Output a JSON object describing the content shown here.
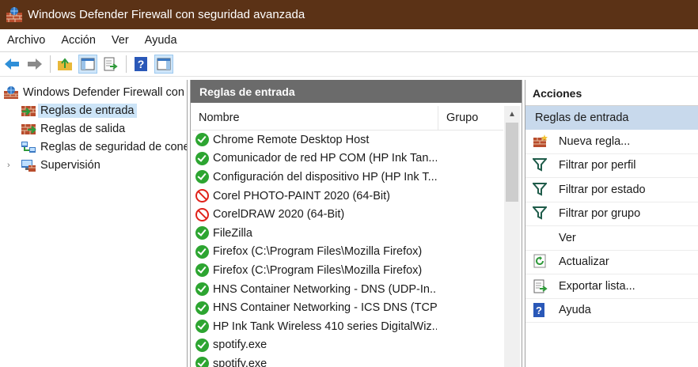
{
  "window": {
    "title": "Windows Defender Firewall con seguridad avanzada"
  },
  "menu": [
    "Archivo",
    "Acción",
    "Ver",
    "Ayuda"
  ],
  "toolbar": {
    "buttons": [
      "back-icon",
      "forward-icon",
      "up-folder-icon",
      "show-hide-tree-icon",
      "export-list-icon",
      "help-icon",
      "show-hide-action-pane-icon"
    ]
  },
  "tree": {
    "root": "Windows Defender Firewall con",
    "items": [
      {
        "label": "Reglas de entrada",
        "selected": true
      },
      {
        "label": "Reglas de salida"
      },
      {
        "label": "Reglas de seguridad de cone"
      },
      {
        "label": "Supervisión",
        "expander": "›"
      }
    ]
  },
  "center": {
    "header": "Reglas de entrada",
    "columns": {
      "name": "Nombre",
      "group": "Grupo"
    },
    "rules": [
      {
        "name": "Chrome Remote Desktop Host",
        "status": "allow"
      },
      {
        "name": "Comunicador de red HP COM (HP Ink Tan...",
        "status": "allow"
      },
      {
        "name": "Configuración del dispositivo HP (HP Ink T...",
        "status": "allow"
      },
      {
        "name": "Corel PHOTO-PAINT 2020 (64-Bit)",
        "status": "block"
      },
      {
        "name": "CorelDRAW 2020 (64-Bit)",
        "status": "block"
      },
      {
        "name": "FileZilla",
        "status": "allow"
      },
      {
        "name": "Firefox (C:\\Program Files\\Mozilla Firefox)",
        "status": "allow"
      },
      {
        "name": "Firefox (C:\\Program Files\\Mozilla Firefox)",
        "status": "allow"
      },
      {
        "name": "HNS Container Networking - DNS (UDP-In...",
        "status": "allow"
      },
      {
        "name": "HNS Container Networking - ICS DNS (TCP...",
        "status": "allow"
      },
      {
        "name": "HP Ink Tank Wireless 410 series DigitalWiz...",
        "status": "allow"
      },
      {
        "name": "spotify.exe",
        "status": "allow"
      },
      {
        "name": "spotify.exe",
        "status": "allow"
      }
    ]
  },
  "actions": {
    "header": "Acciones",
    "section": "Reglas de entrada",
    "items": [
      {
        "label": "Nueva regla...",
        "icon": "new-rule-icon"
      },
      {
        "label": "Filtrar por perfil",
        "icon": "filter-icon"
      },
      {
        "label": "Filtrar por estado",
        "icon": "filter-icon"
      },
      {
        "label": "Filtrar por grupo",
        "icon": "filter-icon"
      },
      {
        "label": "Ver",
        "icon": ""
      },
      {
        "label": "Actualizar",
        "icon": "refresh-icon"
      },
      {
        "label": "Exportar lista...",
        "icon": "export-list-icon"
      },
      {
        "label": "Ayuda",
        "icon": "help-icon"
      }
    ]
  }
}
